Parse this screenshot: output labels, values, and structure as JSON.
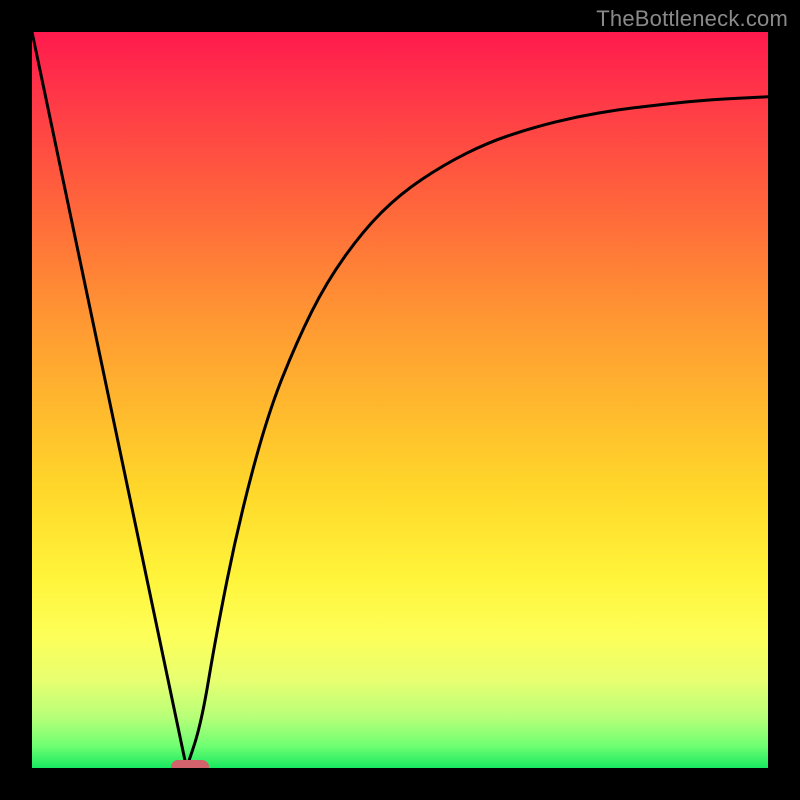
{
  "watermark": "TheBottleneck.com",
  "chart_data": {
    "type": "line",
    "title": "",
    "xlabel": "",
    "ylabel": "",
    "xlim": [
      0,
      1
    ],
    "ylim": [
      0,
      1
    ],
    "gradient_stops": [
      {
        "pos": 0.0,
        "color": "#ff1a4d"
      },
      {
        "pos": 0.1,
        "color": "#ff3b47"
      },
      {
        "pos": 0.25,
        "color": "#ff6a3a"
      },
      {
        "pos": 0.38,
        "color": "#ff9433"
      },
      {
        "pos": 0.5,
        "color": "#ffb62e"
      },
      {
        "pos": 0.62,
        "color": "#ffd72a"
      },
      {
        "pos": 0.74,
        "color": "#fff43a"
      },
      {
        "pos": 0.82,
        "color": "#fdff58"
      },
      {
        "pos": 0.88,
        "color": "#e8ff70"
      },
      {
        "pos": 0.93,
        "color": "#b8ff78"
      },
      {
        "pos": 0.97,
        "color": "#6fff72"
      },
      {
        "pos": 1.0,
        "color": "#18e860"
      }
    ],
    "series": [
      {
        "name": "bottleneck-curve",
        "x": [
          0.0,
          0.05,
          0.1,
          0.15,
          0.19,
          0.21,
          0.23,
          0.25,
          0.28,
          0.32,
          0.36,
          0.4,
          0.45,
          0.5,
          0.56,
          0.62,
          0.68,
          0.74,
          0.8,
          0.86,
          0.92,
          1.0
        ],
        "y": [
          1.0,
          0.76,
          0.52,
          0.28,
          0.09,
          0.0,
          0.06,
          0.18,
          0.33,
          0.48,
          0.58,
          0.66,
          0.73,
          0.78,
          0.82,
          0.85,
          0.87,
          0.885,
          0.895,
          0.902,
          0.908,
          0.912
        ]
      }
    ],
    "marker": {
      "x": 0.215,
      "y": 0.0,
      "color": "#d2636c"
    }
  }
}
